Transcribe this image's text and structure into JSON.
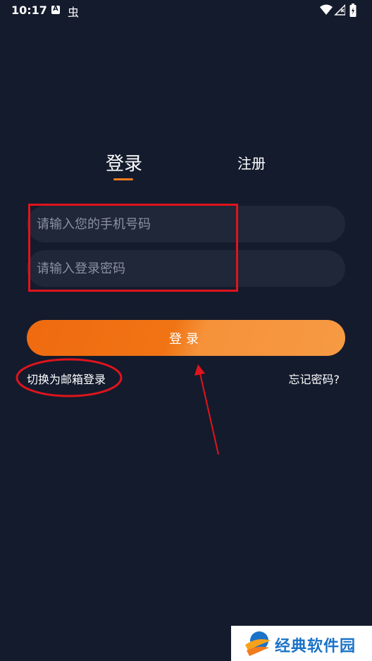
{
  "status_bar": {
    "time": "10:17",
    "a_icon_label": "A",
    "app_icon_glyph": "虫",
    "icons": [
      "wifi-icon",
      "signal-icon",
      "battery-icon"
    ]
  },
  "tabs": [
    {
      "label": "登录",
      "active": true
    },
    {
      "label": "注册",
      "active": false
    }
  ],
  "form": {
    "phone_placeholder": "请输入您的手机号码",
    "password_placeholder": "请输入登录密码",
    "login_button_label": "登录"
  },
  "links": {
    "switch_email": "切换为邮箱登录",
    "forgot_password": "忘记密码?"
  },
  "watermark": {
    "text": "经典软件园"
  },
  "colors": {
    "background": "#141b2d",
    "input_background": "#1f2738",
    "accent": "#f07c1e",
    "annotation_red": "#e0141c",
    "watermark_blue": "#1a73c8"
  }
}
